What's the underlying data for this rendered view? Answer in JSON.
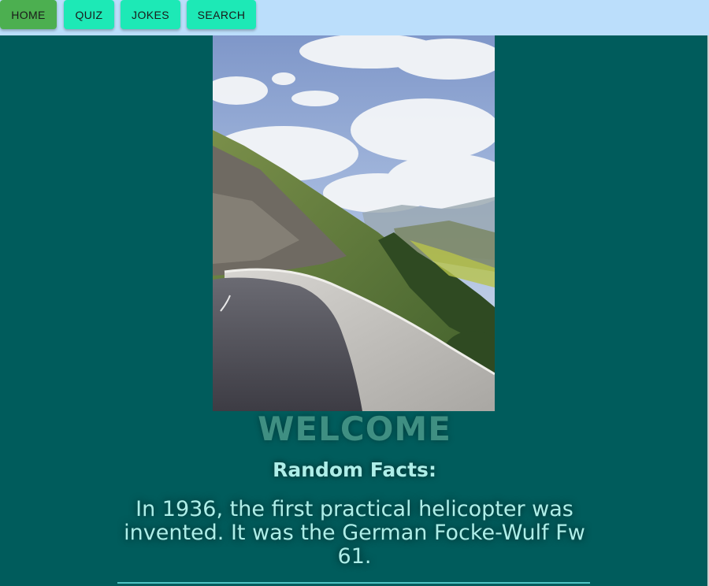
{
  "nav": {
    "home_label": "HOME",
    "quiz_label": "QUIZ",
    "jokes_label": "JOKES",
    "search_label": "SEARCH"
  },
  "colors": {
    "page_background": "#005c5c",
    "nav_background": "#bbdefb",
    "active_button": "#4caf50",
    "button": "#1de9b6",
    "welcome_text": "#3f8f82",
    "fact_text": "#aeeee8"
  },
  "hero_image": {
    "subject": "mountain road with concrete barrier under cloudy sky"
  },
  "welcome": "WELCOME",
  "facts": {
    "heading": "Random Facts:",
    "text": "In 1936, the first practical helicopter was invented. It was the German Focke-Wulf Fw 61."
  }
}
